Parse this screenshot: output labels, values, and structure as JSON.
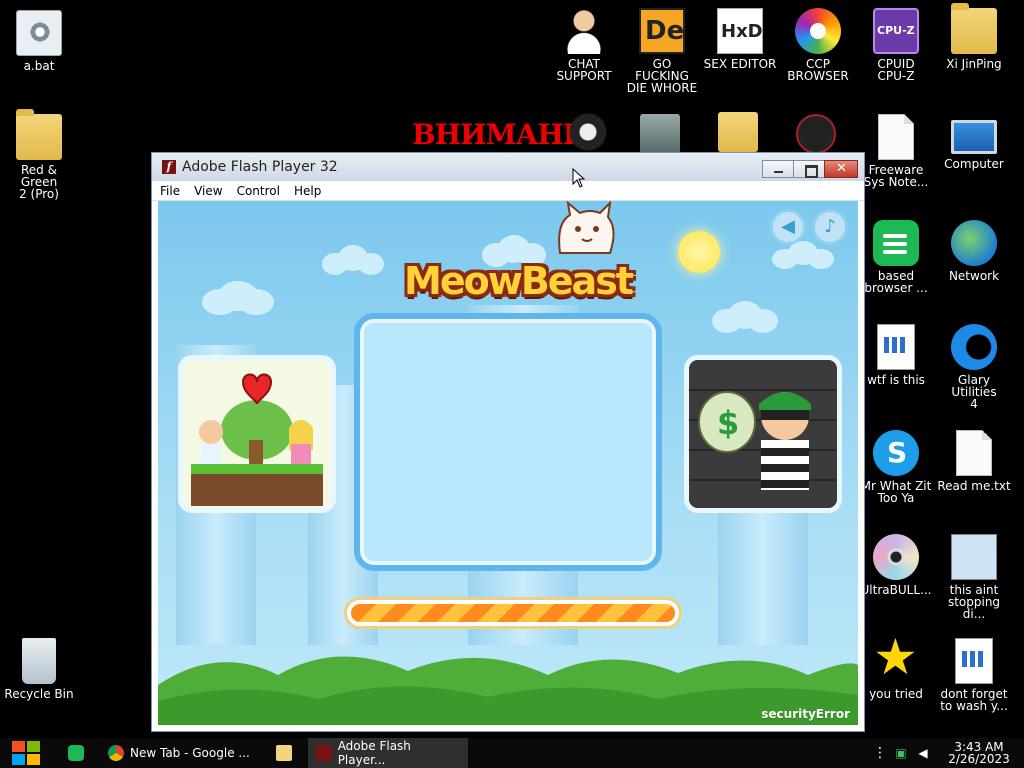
{
  "desktop": {
    "icons": [
      {
        "label": "a.bat",
        "icon": "batch-file-icon"
      },
      {
        "label": "CHAT\nSUPPORT",
        "icon": "person-icon"
      },
      {
        "label": "GO FUCKING\nDIE WHORE",
        "icon": "de-app-icon"
      },
      {
        "label": "SEX EDITOR",
        "icon": "hxd-icon"
      },
      {
        "label": "CCP\nBROWSER",
        "icon": "browser-icon"
      },
      {
        "label": "CPUID\nCPU-Z",
        "icon": "cpuz-icon"
      },
      {
        "label": "Xi JinPing",
        "icon": "folder-icon"
      },
      {
        "label": "Red & Green\n2 (Pro)",
        "icon": "folder-icon"
      },
      {
        "label": "Freeware\nSys Note...",
        "icon": "file-icon"
      },
      {
        "label": "Computer",
        "icon": "computer-icon"
      },
      {
        "label": "based\nbrowser ...",
        "icon": "browser-icon"
      },
      {
        "label": "Network",
        "icon": "network-icon"
      },
      {
        "label": "wtf is this",
        "icon": "file-icon"
      },
      {
        "label": "Glary Utilities\n4",
        "icon": "glary-icon"
      },
      {
        "label": "Mr What Zit\nToo Ya",
        "icon": "skype-icon"
      },
      {
        "label": "Read me.txt",
        "icon": "text-file-icon"
      },
      {
        "label": "UltraBULL...",
        "icon": "disc-icon"
      },
      {
        "label": "this aint\nstopping di...",
        "icon": "search-app-icon"
      },
      {
        "label": "Recycle Bin",
        "icon": "recycle-bin-icon"
      },
      {
        "label": "you tried",
        "icon": "star-icon"
      },
      {
        "label": "dont forget\nto wash y...",
        "icon": "file-icon"
      }
    ],
    "warning_text": "ВНИМАНИ"
  },
  "window": {
    "title": "Adobe Flash Player 32",
    "menu": [
      "File",
      "View",
      "Control",
      "Help"
    ]
  },
  "game": {
    "logo": "MeowBeast",
    "progress": 1.0,
    "status_text": "securityError"
  },
  "taskbar": {
    "tasks": [
      {
        "label": "",
        "icon": "green-app-icon"
      },
      {
        "label": "New Tab - Google ...",
        "icon": "chrome-icon"
      },
      {
        "label": "",
        "icon": "folder-icon"
      },
      {
        "label": "Adobe Flash Player...",
        "icon": "flash-icon"
      }
    ],
    "time": "3:43 AM",
    "date": "2/26/2023"
  },
  "colors": {
    "sky": "#7cc8ee",
    "panel_border": "#5fb6ec",
    "progress_orange": "#ff8a1e",
    "warning_red": "#e00000"
  }
}
